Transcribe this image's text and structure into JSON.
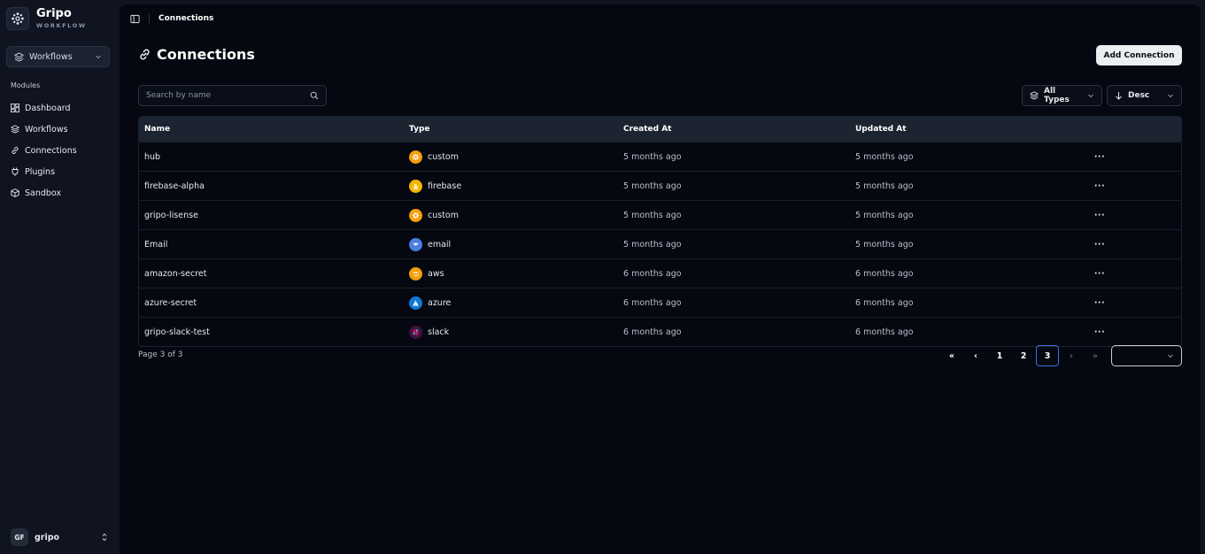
{
  "brand": {
    "name": "Gripo",
    "subtitle": "WORKFLOW"
  },
  "workspace": {
    "selected": "Workflows"
  },
  "sidebar": {
    "section_label": "Modules",
    "items": [
      {
        "label": "Dashboard",
        "icon": "dashboard-icon"
      },
      {
        "label": "Workflows",
        "icon": "layers-icon"
      },
      {
        "label": "Connections",
        "icon": "link-icon"
      },
      {
        "label": "Plugins",
        "icon": "plug-icon"
      },
      {
        "label": "Sandbox",
        "icon": "cube-icon"
      }
    ]
  },
  "user": {
    "initials": "GF",
    "name": "gripo"
  },
  "breadcrumb": {
    "current": "Connections"
  },
  "page": {
    "title": "Connections",
    "add_button": "Add Connection"
  },
  "search": {
    "placeholder": "Search by name",
    "value": ""
  },
  "filters": {
    "type": "All Types",
    "sort": "Desc"
  },
  "table": {
    "columns": {
      "name": "Name",
      "type": "Type",
      "created": "Created At",
      "updated": "Updated At"
    },
    "rows": [
      {
        "name": "hub",
        "type": "custom",
        "created": "5 months ago",
        "updated": "5 months ago",
        "actions": "···"
      },
      {
        "name": "firebase-alpha",
        "type": "firebase",
        "created": "5 months ago",
        "updated": "5 months ago",
        "actions": "···"
      },
      {
        "name": "gripo-lisense",
        "type": "custom",
        "created": "5 months ago",
        "updated": "5 months ago",
        "actions": "···"
      },
      {
        "name": "Email",
        "type": "email",
        "created": "5 months ago",
        "updated": "5 months ago",
        "actions": "···"
      },
      {
        "name": "amazon-secret",
        "type": "aws",
        "created": "6 months ago",
        "updated": "6 months ago",
        "actions": "···"
      },
      {
        "name": "azure-secret",
        "type": "azure",
        "created": "6 months ago",
        "updated": "6 months ago",
        "actions": "···"
      },
      {
        "name": "gripo-slack-test",
        "type": "slack",
        "created": "6 months ago",
        "updated": "6 months ago",
        "actions": "···"
      }
    ]
  },
  "pagination": {
    "info": "Page 3 of 3",
    "first": "«",
    "prev": "‹",
    "pages": [
      "1",
      "2",
      "3"
    ],
    "current": "3",
    "next": "›",
    "last": "»"
  },
  "colors": {
    "custom": "#f59e0b",
    "firebase": "#f5b400",
    "email": "#4a7fe0",
    "aws": "#f59e0b",
    "azure": "#0f78d4",
    "slack": "#3a1340",
    "active_page": "#3d6fd8"
  }
}
